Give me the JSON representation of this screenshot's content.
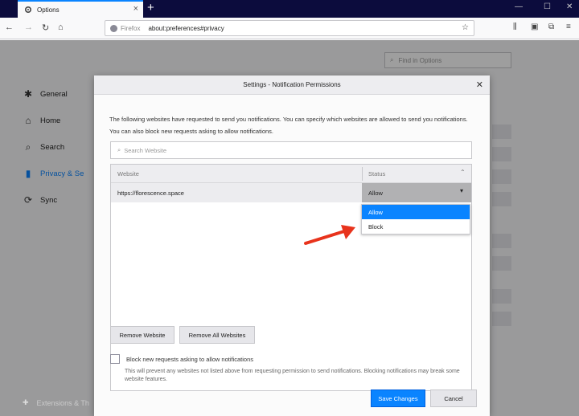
{
  "browser": {
    "tab_title": "Options",
    "url_identity": "Firefox",
    "url": "about:preferences#privacy"
  },
  "sidebar": {
    "items": [
      {
        "label": "General",
        "icon": "gear-icon"
      },
      {
        "label": "Home",
        "icon": "home-icon"
      },
      {
        "label": "Search",
        "icon": "search-icon"
      },
      {
        "label": "Privacy & Se",
        "icon": "lock-icon"
      },
      {
        "label": "Sync",
        "icon": "sync-icon"
      }
    ],
    "bottom_item": "Extensions & Th"
  },
  "find_placeholder": "Find in Options",
  "dialog": {
    "title": "Settings - Notification Permissions",
    "description": "The following websites have requested to send you notifications. You can specify which websites are allowed to send you notifications. You can also block new requests asking to allow notifications.",
    "search_placeholder": "Search Website",
    "columns": {
      "website": "Website",
      "status": "Status"
    },
    "rows": [
      {
        "website": "https://florescence.space",
        "status": "Allow"
      }
    ],
    "status_options": [
      {
        "label": "Allow",
        "selected": true
      },
      {
        "label": "Block",
        "selected": false
      }
    ],
    "remove_website": "Remove Website",
    "remove_all": "Remove All Websites",
    "block_checkbox_label": "Block new requests asking to allow notifications",
    "block_checked": false,
    "block_help": "This will prevent any websites not listed above from requesting permission to send notifications. Blocking notifications may break some website features.",
    "save": "Save Changes",
    "cancel": "Cancel"
  },
  "colors": {
    "accent": "#0a84ff",
    "annotation_arrow": "#e8331c"
  }
}
